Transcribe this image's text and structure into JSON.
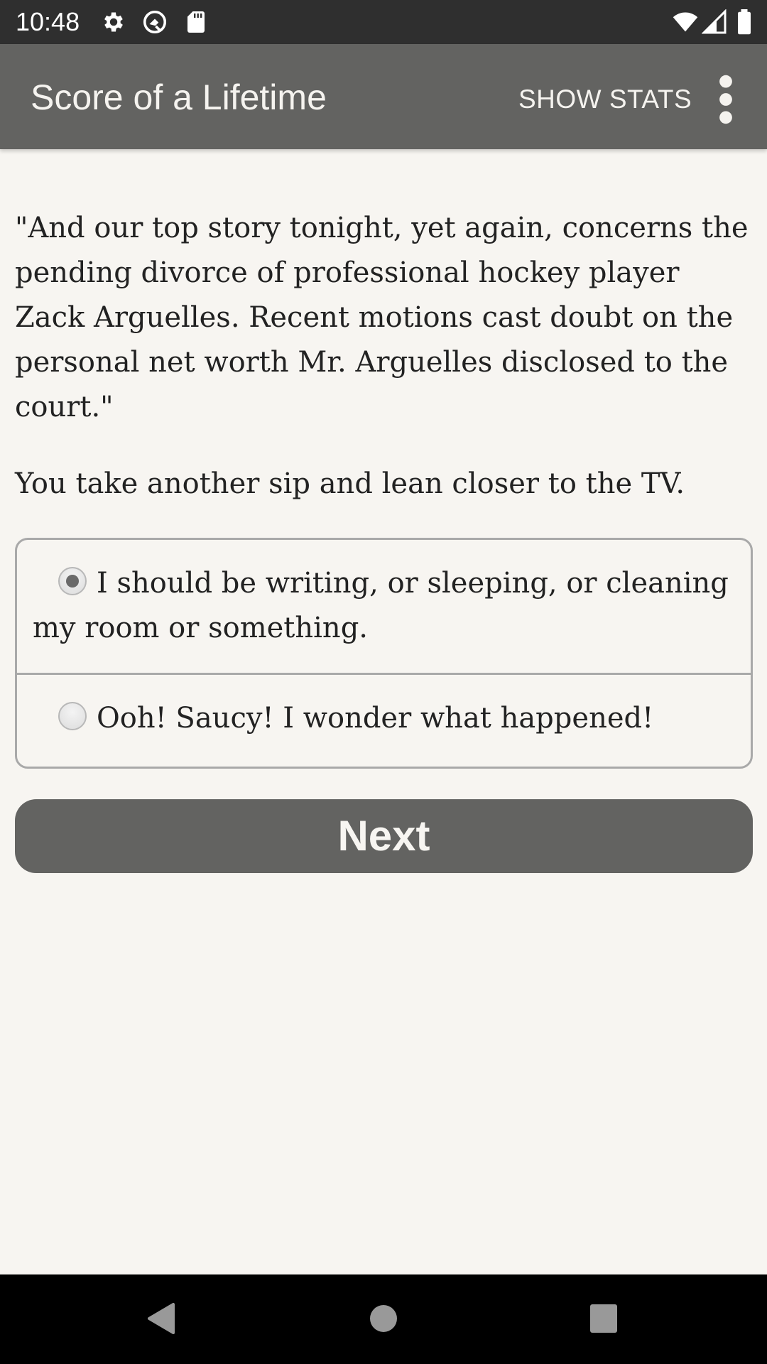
{
  "status_bar": {
    "time": "10:48",
    "left_icons": [
      "gear-icon",
      "q-logo-icon",
      "sd-card-icon"
    ],
    "right_icons": [
      "wifi-icon",
      "cell-signal-icon",
      "battery-icon"
    ]
  },
  "app_bar": {
    "title": "Score of a Lifetime",
    "show_stats_label": "SHOW STATS",
    "overflow_icon": "more-vert-icon"
  },
  "story": {
    "paragraphs": [
      "\"And our top story tonight, yet again, concerns the pending divorce of professional hockey player Zack Arguelles. Recent motions cast doubt on the personal net worth Mr. Arguelles disclosed to the court.\"",
      "You take another sip and lean closer to the TV."
    ]
  },
  "choices": {
    "options": [
      {
        "label": "I should be writing, or sleeping, or cleaning my room or something.",
        "selected": true
      },
      {
        "label": "Ooh! Saucy! I wonder what happened!",
        "selected": false
      }
    ]
  },
  "next_button": {
    "label": "Next"
  },
  "nav_bar": {
    "buttons": [
      "back-icon",
      "home-icon",
      "recents-icon"
    ]
  },
  "colors": {
    "status_bar_bg": "#2f2f2f",
    "app_bar_bg": "#636361",
    "page_bg": "#f7f5f1",
    "button_bg": "#636361",
    "border": "#a9a9a9",
    "nav_bar_bg": "#000000"
  }
}
